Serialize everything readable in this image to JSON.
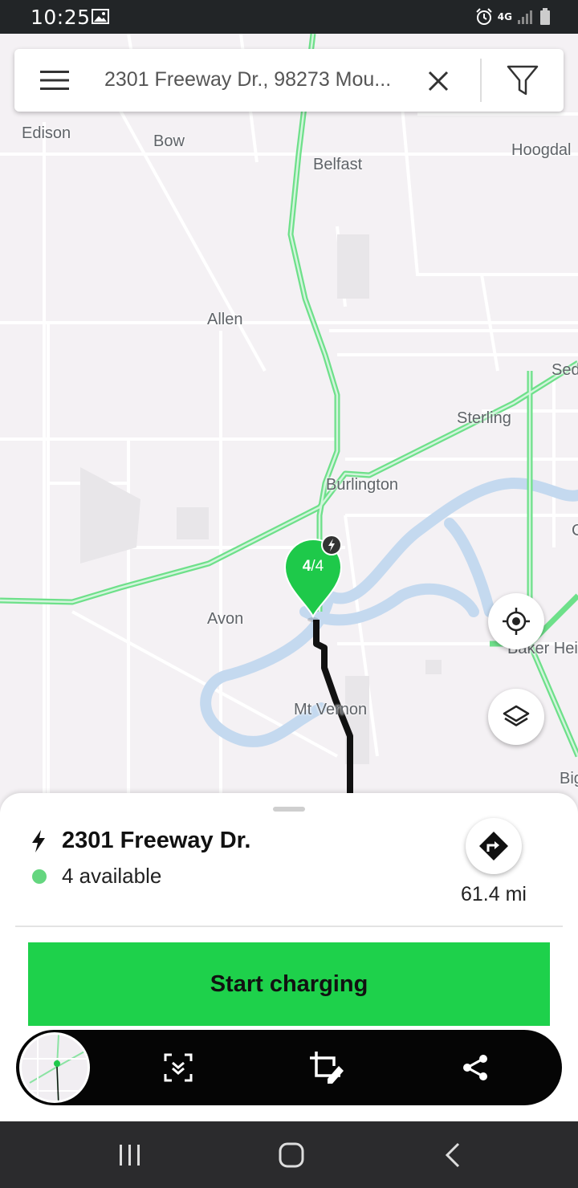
{
  "status_bar": {
    "time": "10:25",
    "network": "4G",
    "icons": [
      "image-icon",
      "alarm-icon",
      "network-4g-icon",
      "signal-icon",
      "battery-icon"
    ]
  },
  "search": {
    "query": "2301 Freeway Dr., 98273 Mou...",
    "icons": [
      "menu-icon",
      "clear-icon",
      "filter-icon"
    ]
  },
  "map": {
    "places": {
      "edison": "Edison",
      "bow": "Bow",
      "belfast": "Belfast",
      "hoogdal": "Hoogdal",
      "allen": "Allen",
      "sed": "Sed",
      "sterling": "Sterling",
      "burlington": "Burlington",
      "c": "C",
      "avon": "Avon",
      "baker_hei": "Baker Hei",
      "mt_vernon": "Mt Vernon",
      "big": "Big"
    },
    "marker": {
      "available": "4",
      "separator": "/",
      "total": "4"
    },
    "colors": {
      "road_highlight": "#6ee08a",
      "route": "#111111",
      "water": "#c4d9ef",
      "marker": "#1ec94a"
    }
  },
  "station": {
    "name": "2301 Freeway Dr.",
    "availability": "4 available",
    "distance": "61.4 mi",
    "status_color": "#64d67f"
  },
  "actions": {
    "start_label": "Start charging",
    "start_color": "#1ed14b"
  },
  "capture_toolbar": {
    "buttons": [
      "scroll-capture-icon",
      "crop-edit-icon",
      "share-icon"
    ]
  },
  "nav_bar": {
    "buttons": [
      "recent-apps-icon",
      "home-icon",
      "back-icon"
    ]
  }
}
